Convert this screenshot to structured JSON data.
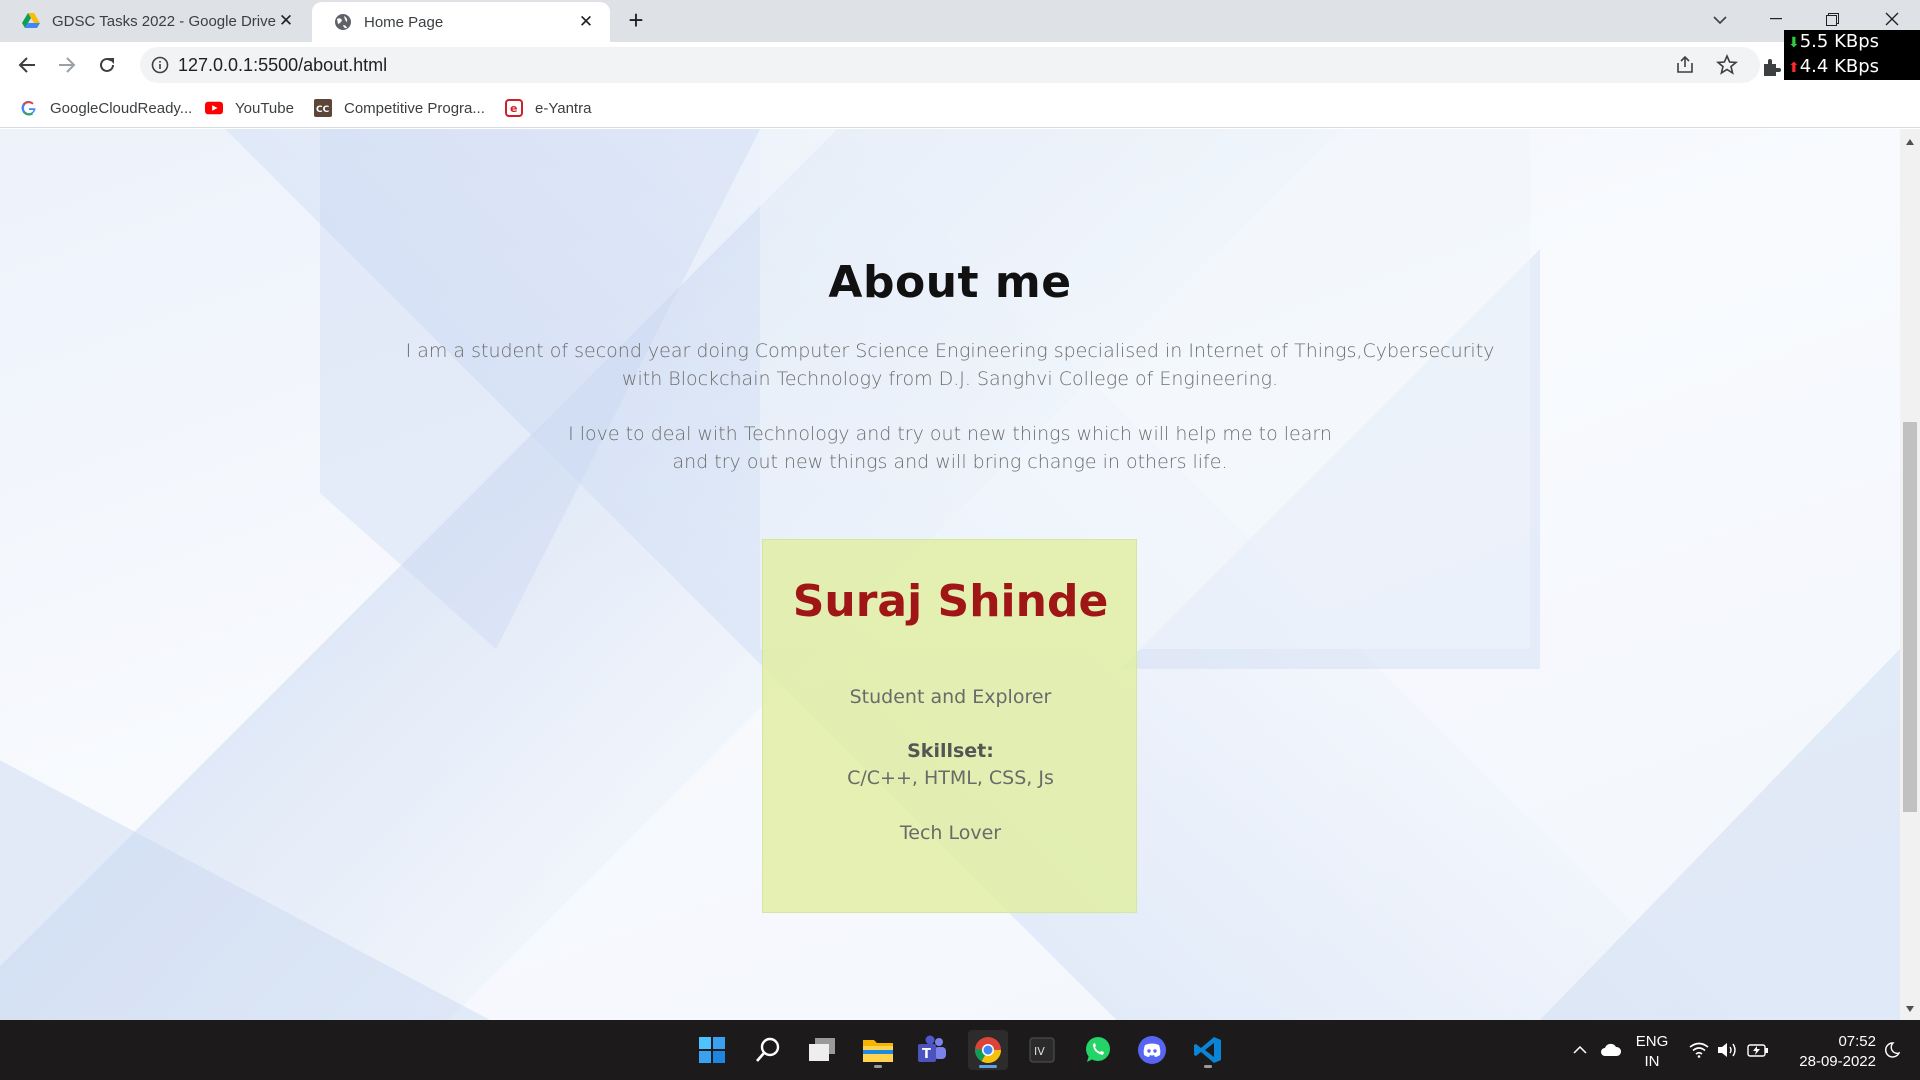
{
  "browser": {
    "tabs": [
      {
        "title": "GDSC Tasks 2022 - Google Drive",
        "favicon": "google-drive-icon",
        "active": false
      },
      {
        "title": "Home Page",
        "favicon": "globe-icon",
        "active": true
      }
    ],
    "address": "127.0.0.1:5500/about.html",
    "bookmarks": [
      {
        "label": "GoogleCloudReady...",
        "icon": "google-icon"
      },
      {
        "label": "YouTube",
        "icon": "youtube-icon"
      },
      {
        "label": "Competitive Progra...",
        "icon": "codechef-icon"
      },
      {
        "label": "e-Yantra",
        "icon": "e-yantra-icon"
      }
    ]
  },
  "netspeed": {
    "download": "5.5 KBps",
    "upload": "4.4 KBps"
  },
  "page": {
    "heading": "About me",
    "para1_line1": "I am a student of second year doing Computer Science Engineering specialised in Internet of Things,Cybersecurity",
    "para1_line2": "with Blockchain Technology from D.J. Sanghvi College of Engineering.",
    "para2_line1": "I love to deal with Technology and try out new things which will help me to learn",
    "para2_line2": "and try out new things and will bring change in others life.",
    "card": {
      "name": "Suraj Shinde",
      "role": "Student and Explorer",
      "skill_label": "Skillset:",
      "skills": "C/C++, HTML, CSS, Js",
      "tagline": "Tech Lover"
    }
  },
  "taskbar": {
    "apps": [
      "start-icon",
      "search-icon",
      "task-view-icon",
      "file-explorer-icon",
      "teams-icon",
      "chrome-icon",
      "code-editor-icon",
      "whatsapp-icon",
      "discord-icon",
      "vscode-icon"
    ],
    "lang_line1": "ENG",
    "lang_line2": "IN",
    "time": "07:52",
    "date": "28-09-2022"
  },
  "colors": {
    "card_bg": "#e2eea4",
    "name_color": "#a01515",
    "accent_blue": "#1a73e8"
  }
}
